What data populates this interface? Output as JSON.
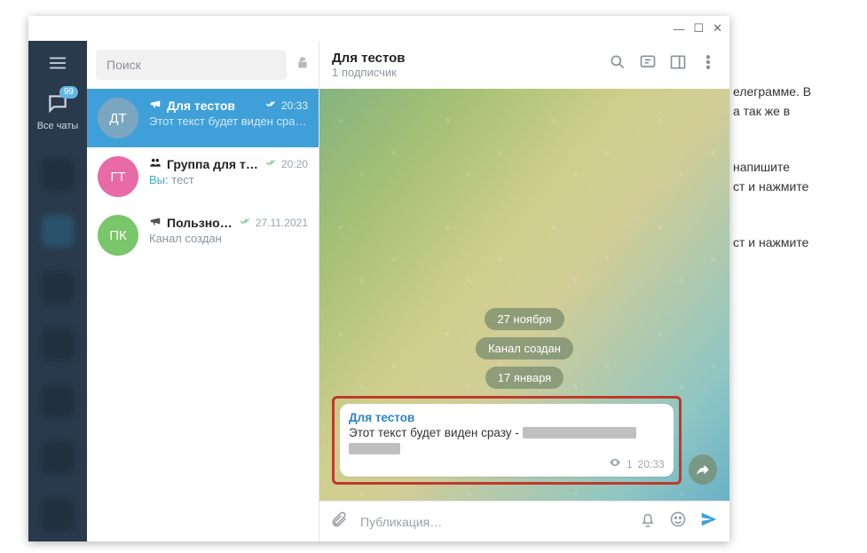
{
  "window": {
    "min": "—",
    "max": "☐",
    "close": "✕"
  },
  "nav": {
    "all_chats": "Все чаты",
    "badge": "99"
  },
  "search": {
    "placeholder": "Поиск"
  },
  "chats": [
    {
      "avatar": "ДТ",
      "name": "Для тестов",
      "time": "20:33",
      "preview": "Этот текст будет виден сраз…"
    },
    {
      "avatar": "ГТ",
      "name": "Группа для те…",
      "time": "20:20",
      "you": "Вы:",
      "preview": "тест"
    },
    {
      "avatar": "ПК",
      "name": "Пользно…",
      "time": "27.11.2021",
      "preview": "Канал создан"
    }
  ],
  "header": {
    "title": "Для тестов",
    "subtitle": "1 подписчик"
  },
  "convo": {
    "date1": "27 ноября",
    "service": "Канал создан",
    "date2": "17 января",
    "msg": {
      "from": "Для тестов",
      "text": "Этот текст будет виден сразу -",
      "views": "1",
      "time": "20:33"
    }
  },
  "composer": {
    "placeholder": "Публикация…"
  },
  "bg": {
    "p1a": "елеграмме. В",
    "p1b": "а так же в",
    "p2a": "напишите",
    "p2b": "ст и нажмите",
    "p3": "ст и нажмите"
  }
}
